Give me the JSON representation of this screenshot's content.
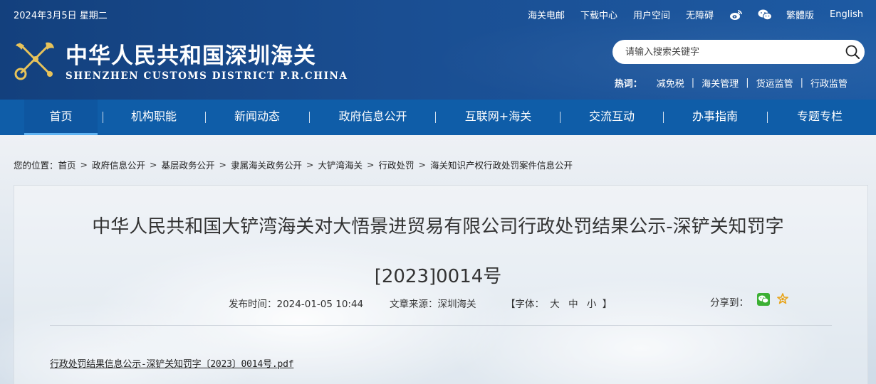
{
  "header": {
    "date": "2024年3月5日 星期二",
    "top_links": [
      "海关电邮",
      "下载中心",
      "用户空间",
      "无障碍"
    ],
    "lang_links": [
      "繁體版",
      "English"
    ],
    "site_name": "中华人民共和国深圳海关",
    "site_name_en": "SHENZHEN CUSTOMS DISTRICT P.R.CHINA",
    "search_placeholder": "请输入搜索关键字",
    "hot_label": "热词：",
    "hot_words": [
      "减免税",
      "海关管理",
      "货运监管",
      "行政监管"
    ]
  },
  "nav": {
    "items": [
      "首页",
      "机构职能",
      "新闻动态",
      "政府信息公开",
      "互联网+海关",
      "交流互动",
      "办事指南",
      "专题专栏"
    ],
    "active_index": 0,
    "separator": "|"
  },
  "breadcrumb": {
    "label": "您的位置：",
    "items": [
      "首页",
      "政府信息公开",
      "基层政务公开",
      "隶属海关政务公开",
      "大铲湾海关",
      "行政处罚",
      "海关知识产权行政处罚案件信息公开"
    ],
    "separator": ">"
  },
  "article": {
    "title_line1": "中华人民共和国大铲湾海关对大悟景进贸易有限公司行政处罚结果公示-深铲关知罚字",
    "title_line2": "[2023]0014号",
    "publish_time": "发布时间：2024-01-05 10:44",
    "source": "文章来源：深圳海关",
    "font_size_label": "【字体：",
    "font_sizes": [
      "大",
      "中",
      "小"
    ],
    "font_size_end": "】",
    "share_label": "分享到：",
    "attachment": "行政处罚结果信息公示-深铲关知罚字〔2023〕0014号.pdf"
  },
  "colors": {
    "header_bg": "#1a4e92",
    "nav_bg": "#0f5da8",
    "nav_active_underline": "#5fb3f2"
  }
}
